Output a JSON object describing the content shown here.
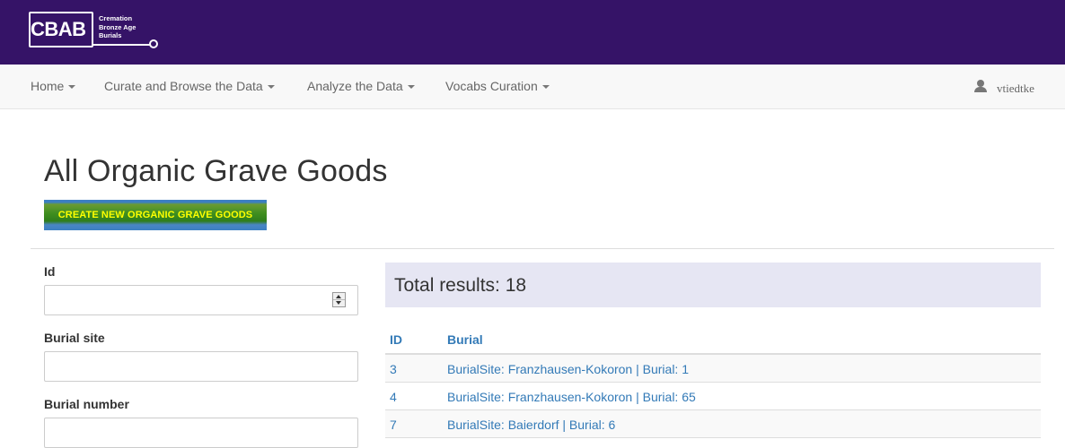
{
  "header": {
    "logo": {
      "abbr": "CBAB",
      "line1": "Cremation",
      "line2": "Bronze Age",
      "line3": "Burials"
    }
  },
  "nav": {
    "items": [
      "Home",
      "Curate and Browse the Data",
      "Analyze the Data",
      "Vocabs Curation"
    ],
    "user": "vtiedtke"
  },
  "page": {
    "title": "All Organic Grave Goods",
    "create_button": "CREATE NEW ORGANIC GRAVE GOODS"
  },
  "filters": {
    "id_label": "Id",
    "id_value": "",
    "burial_site_label": "Burial site",
    "burial_site_value": "",
    "burial_number_label": "Burial number",
    "burial_number_value": ""
  },
  "results": {
    "total": "Total results: 18",
    "columns": [
      "ID",
      "Burial"
    ],
    "rows": [
      {
        "id": "3",
        "burial": "BurialSite: Franzhausen-Kokoron | Burial: 1"
      },
      {
        "id": "4",
        "burial": "BurialSite: Franzhausen-Kokoron | Burial: 65"
      },
      {
        "id": "7",
        "burial": "BurialSite: Baierdorf | Burial: 6"
      }
    ]
  },
  "colors": {
    "banner": "#351367",
    "link": "#337ab7",
    "results_bg": "#e6e6f3",
    "button_text": "#ffff00"
  }
}
